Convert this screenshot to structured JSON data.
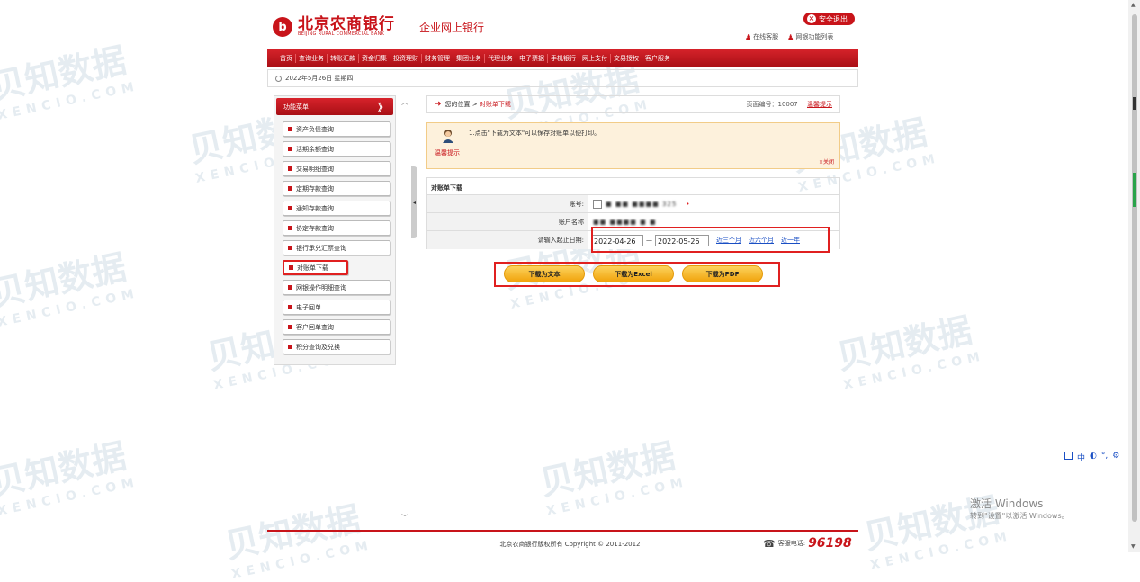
{
  "header": {
    "bank_name": "北京农商银行",
    "bank_name_en": "BEIJING RURAL COMMERCIAL BANK",
    "product": "企业网上银行",
    "logout": "安全退出",
    "links": [
      "在线客服",
      "网银功能列表"
    ]
  },
  "nav": {
    "items": [
      "首页",
      "查询业务",
      "转账汇款",
      "资金归集",
      "投资理财",
      "财务管理",
      "集团业务",
      "代理业务",
      "电子票据",
      "手机银行",
      "网上支付",
      "交易授权",
      "客户服务"
    ]
  },
  "date_bar": {
    "date": "2022年5月26日 星期四"
  },
  "sidebar": {
    "title": "功能菜单",
    "toggle": "》",
    "items": [
      "资产负债查询",
      "活期余额查询",
      "交易明细查询",
      "定期存款查询",
      "通知存款查询",
      "协定存款查询",
      "银行承兑汇票查询",
      "对账单下载",
      "网银操作明细查询",
      "电子回单",
      "客户回单查询",
      "积分查询及兑换"
    ]
  },
  "breadcrumb": {
    "prefix": "您的位置 >",
    "current": "对账单下载",
    "page_no": "页面编号：10007",
    "tip_link": "温馨提示"
  },
  "tip": {
    "text": "1.点击\"下载为文本\"可以保存对账单以便打印。",
    "label": "温馨提示",
    "close": "×关闭"
  },
  "form": {
    "section_title": "对账单下载",
    "account_label": "账号:",
    "account_value": "■ ■■ ■■■■ 325",
    "account_name_label": "账户名称",
    "account_name_value": "■■ ■■■■ ■ ■",
    "date_label": "请输入起止日期:",
    "start_date": "2022-04-26",
    "dash": "—",
    "end_date": "2022-05-26",
    "quick_links": [
      "近三个月",
      "近六个月",
      "近一年"
    ]
  },
  "buttons": {
    "text": "下载为文本",
    "excel": "下载为Excel",
    "pdf": "下载为PDF"
  },
  "footer": {
    "copyright": "北京农商银行版权所有 Copyright © 2011-2012",
    "hotline_label": "客服电话:",
    "hotline_number": "96198"
  },
  "watermark": {
    "cn": "贝知数据",
    "en": "XENCIO.COM"
  },
  "windows": {
    "title": "激活 Windows",
    "sub": "转到\"设置\"以激活 Windows。"
  },
  "ime": [
    "中",
    "◐",
    "°,",
    "⚙"
  ],
  "colors": {
    "brand": "#c8141a",
    "button": "#f5b01e",
    "highlight": "#e02020",
    "link": "#1a4fc4"
  }
}
